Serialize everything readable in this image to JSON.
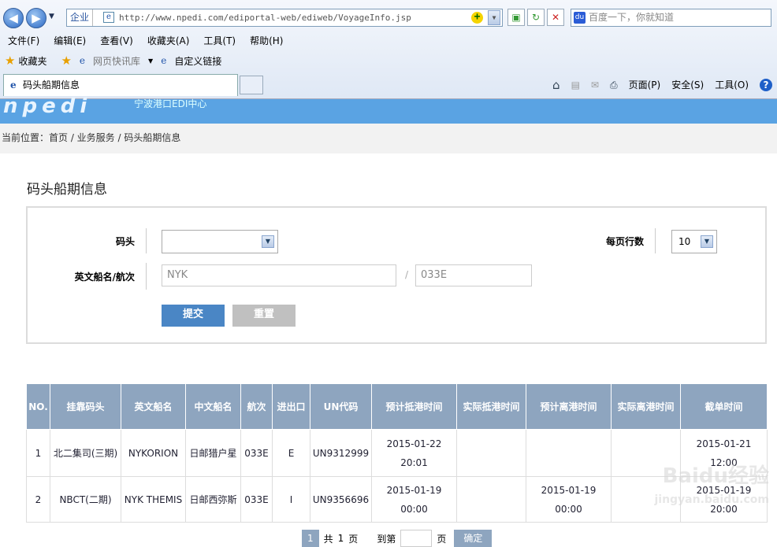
{
  "browser": {
    "url": "http://www.npedi.com/ediportal-web/ediweb/VoyageInfo.jsp",
    "zone": "企业",
    "search_placeholder": "百度一下，你就知道",
    "tab_title": "码头船期信息",
    "menus": [
      "文件(F)",
      "编辑(E)",
      "查看(V)",
      "收藏夹(A)",
      "工具(T)",
      "帮助(H)"
    ],
    "favorites": "收藏夹",
    "fav_items": [
      "网页快讯库",
      "自定义链接"
    ],
    "commands": [
      "页面(P)",
      "安全(S)",
      "工具(O)"
    ]
  },
  "banner": {
    "subtitle": "宁波港口EDI中心"
  },
  "breadcrumb": "当前位置：首页 / 业务服务 / 码头船期信息",
  "page_title": "码头船期信息",
  "form": {
    "terminal_label": "码头",
    "terminal_value": "",
    "rows_label": "每页行数",
    "rows_value": "10",
    "vessel_label": "英文船名/航次",
    "vessel_value": "NYK",
    "voyage_value": "033E",
    "sep": "/",
    "submit": "提交",
    "reset": "重置"
  },
  "table": {
    "headers": [
      "NO.",
      "挂靠码头",
      "英文船名",
      "中文船名",
      "航次",
      "进出口",
      "UN代码",
      "预计抵港时间",
      "实际抵港时间",
      "预计离港时间",
      "实际离港时间",
      "截单时间"
    ],
    "rows": [
      [
        "1",
        "北二集司(三期)",
        "NYKORION",
        "日邮猎户星",
        "033E",
        "E",
        "UN9312999",
        "2015-01-22 20:01",
        "",
        "",
        "",
        "2015-01-21 12:00"
      ],
      [
        "2",
        "NBCT(二期)",
        "NYK THEMIS",
        "日邮西弥斯",
        "033E",
        "I",
        "UN9356696",
        "2015-01-19 00:00",
        "",
        "2015-01-19 00:00",
        "",
        "2015-01-19 20:00"
      ]
    ]
  },
  "pager": {
    "current": "1",
    "total_prefix": "共",
    "total": "1",
    "total_suffix": "页",
    "goto": "到第",
    "page": "页",
    "confirm": "确定"
  },
  "watermark": {
    "line1": "Baidu经验",
    "line2": "jingyan.baidu.com"
  }
}
